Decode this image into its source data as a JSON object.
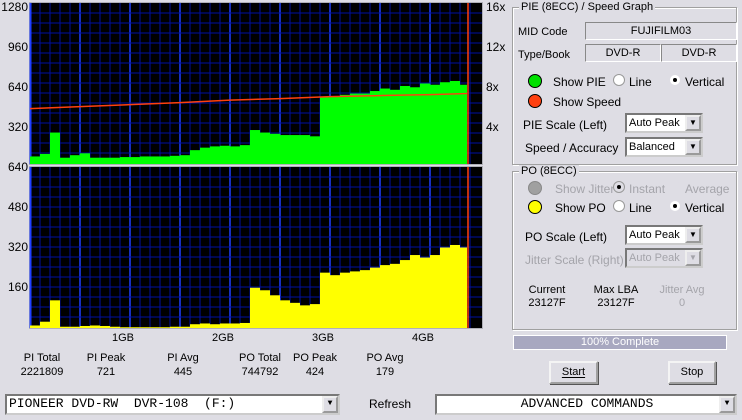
{
  "chart_data": [
    {
      "type": "bar",
      "title": "PIE (8ECC)",
      "left_axis_ticks": [
        "1280",
        "960",
        "640",
        "320"
      ],
      "ylim": [
        0,
        1280
      ],
      "right_axis_ticks": [
        "16x",
        "12x",
        "8x",
        "4x"
      ],
      "speed_lim": [
        0,
        16
      ],
      "xlim_gb": [
        0,
        4.5
      ],
      "x_gb": [
        0,
        0.1,
        0.2,
        0.3,
        0.4,
        0.5,
        0.6,
        0.7,
        0.8,
        0.9,
        1.0,
        1.1,
        1.2,
        1.3,
        1.4,
        1.5,
        1.6,
        1.7,
        1.8,
        1.9,
        2.0,
        2.1,
        2.2,
        2.3,
        2.4,
        2.5,
        2.6,
        2.7,
        2.8,
        2.9,
        3.0,
        3.1,
        3.2,
        3.3,
        3.4,
        3.5,
        3.6,
        3.7,
        3.8,
        3.9,
        4.0,
        4.1,
        4.2,
        4.3
      ],
      "pie": [
        60,
        80,
        250,
        50,
        70,
        85,
        50,
        50,
        50,
        55,
        55,
        60,
        60,
        60,
        65,
        70,
        110,
        130,
        140,
        145,
        140,
        150,
        270,
        250,
        240,
        230,
        230,
        230,
        220,
        530,
        540,
        550,
        560,
        560,
        580,
        600,
        590,
        620,
        610,
        640,
        630,
        650,
        660,
        630
      ],
      "speed_x_gb": [
        0,
        0.5,
        1,
        1.5,
        2,
        2.5,
        3,
        3.5,
        4,
        4.37
      ],
      "speed": [
        5.5,
        5.7,
        5.9,
        6.1,
        6.35,
        6.5,
        6.7,
        6.8,
        6.9,
        7.0
      ],
      "end_gb": 4.37,
      "bar_color": "#00ff00",
      "speed_color": "#ff4010",
      "grid": true
    },
    {
      "type": "bar",
      "title": "PO (8ECC)",
      "left_axis_ticks": [
        "640",
        "480",
        "320",
        "160"
      ],
      "ylim": [
        0,
        640
      ],
      "xlim_gb": [
        0,
        4.5
      ],
      "x_tick_labels": [
        "1GB",
        "2GB",
        "3GB",
        "4GB"
      ],
      "po": [
        10,
        25,
        110,
        5,
        5,
        8,
        10,
        8,
        5,
        3,
        3,
        3,
        3,
        3,
        5,
        5,
        15,
        18,
        15,
        18,
        18,
        20,
        160,
        150,
        130,
        110,
        100,
        90,
        95,
        220,
        210,
        220,
        225,
        230,
        240,
        250,
        255,
        270,
        290,
        280,
        290,
        320,
        330,
        320
      ],
      "bar_color": "#ffff00",
      "grid": true
    }
  ],
  "stats": {
    "labels": [
      "PI Total",
      "PI Peak",
      "PI Avg",
      "PO Total",
      "PO Peak",
      "PO Avg"
    ],
    "values": [
      "2221809",
      "721",
      "445",
      "744792",
      "424",
      "179"
    ]
  },
  "pie_group": {
    "title": "PIE (8ECC) / Speed Graph",
    "mid_label": "MID Code",
    "mid_value": "FUJIFILM03",
    "type_label": "Type/Book",
    "type_value": "DVD-R",
    "book_value": "DVD-R",
    "show_pie": "Show PIE",
    "line": "Line",
    "vertical": "Vertical",
    "show_speed": "Show Speed",
    "scale_label": "PIE Scale (Left)",
    "scale_value": "Auto Peak",
    "speed_label": "Speed / Accuracy",
    "speed_value": "Balanced"
  },
  "po_group": {
    "title": "PO (8ECC)",
    "show_jitter": "Show Jitter",
    "instant": "Instant",
    "average": "Average",
    "show_po": "Show PO",
    "line": "Line",
    "vertical": "Vertical",
    "scale_label": "PO Scale (Left)",
    "scale_value": "Auto Peak",
    "jitter_label": "Jitter Scale (Right)",
    "jitter_value": "Auto Peak",
    "current_label": "Current",
    "current_value": "23127F",
    "maxlba_label": "Max LBA",
    "maxlba_value": "23127F",
    "javg_label": "Jitter Avg",
    "javg_value": "0"
  },
  "progress": {
    "text": "100% Complete",
    "percent": 100
  },
  "buttons": {
    "start": "Start",
    "stop": "Stop",
    "refresh": "Refresh"
  },
  "drive": "PIONEER DVD-RW  DVR-108  (F:)",
  "advanced": "ADVANCED COMMANDS",
  "colors": {
    "pie_led": "#00e000",
    "speed_led": "#ff4010",
    "po_led": "#ffff00",
    "jitter_led": "#a0a0a0"
  }
}
